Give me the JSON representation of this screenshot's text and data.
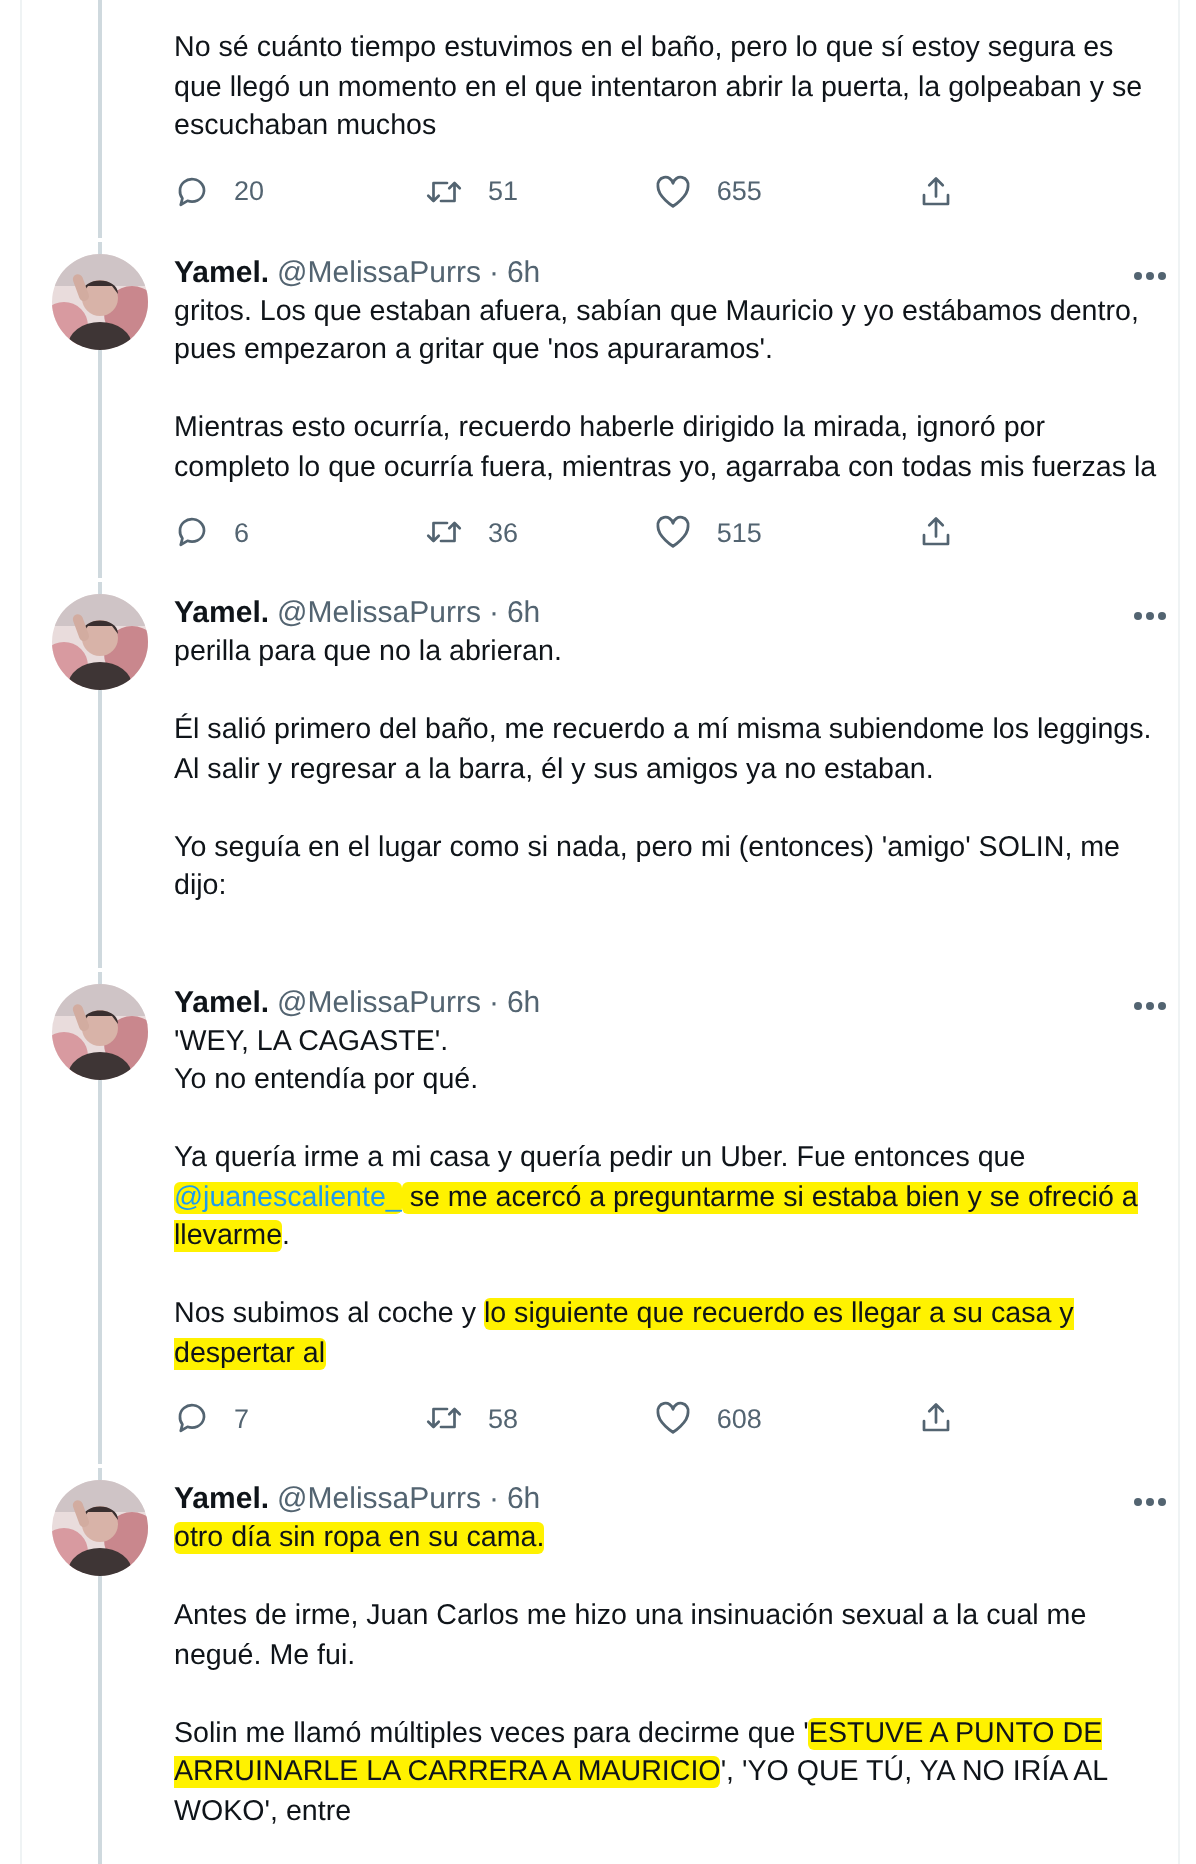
{
  "tweets": [
    {
      "paragraphs": [
        [
          {
            "kind": "text",
            "text": "No sé cuánto tiempo estuvimos en el baño, pero lo que sí estoy segura es que llegó un momento en el que intentaron abrir la puerta, la golpeaban y se escuchaban muchos",
            "highlight": false
          }
        ]
      ],
      "stats": {
        "replies": "20",
        "retweets": "51",
        "likes": "655"
      }
    },
    {
      "author": {
        "name": "Yamel.",
        "handle": "@MelissaPurrs",
        "dot": "·",
        "time": "6h"
      },
      "paragraphs": [
        [
          {
            "kind": "text",
            "text": "gritos. Los que estaban afuera, sabían que Mauricio y yo estábamos dentro, pues empezaron a gritar que 'nos apuraramos'.",
            "highlight": false
          }
        ],
        [
          {
            "kind": "text",
            "text": "Mientras esto ocurría, recuerdo haberle dirigido la mirada, ignoró por completo lo que ocurría fuera, mientras yo, agarraba con todas mis fuerzas la",
            "highlight": false
          }
        ]
      ],
      "stats": {
        "replies": "6",
        "retweets": "36",
        "likes": "515"
      }
    },
    {
      "author": {
        "name": "Yamel.",
        "handle": "@MelissaPurrs",
        "dot": "·",
        "time": "6h"
      },
      "paragraphs": [
        [
          {
            "kind": "text",
            "text": "perilla para que no la abrieran.",
            "highlight": false
          }
        ],
        [
          {
            "kind": "text",
            "text": "Él salió primero del baño, me recuerdo a mí misma subiendome los leggings.\nAl salir y regresar a la barra, él y sus amigos ya no estaban.",
            "highlight": false
          }
        ],
        [
          {
            "kind": "text",
            "text": "Yo seguía en el lugar como si nada, pero mi (entonces) 'amigo' SOLIN, me dijo:",
            "highlight": false
          }
        ]
      ]
    },
    {
      "author": {
        "name": "Yamel.",
        "handle": "@MelissaPurrs",
        "dot": "·",
        "time": "6h"
      },
      "paragraphs": [
        [
          {
            "kind": "text",
            "text": "'WEY, LA CAGASTE'.\nYo no entendía por qué.",
            "highlight": false
          }
        ],
        [
          {
            "kind": "text",
            "text": "Ya quería irme a mi casa y quería pedir un Uber. Fue entonces que ",
            "highlight": false
          },
          {
            "kind": "mention",
            "text": "@juanescaliente_",
            "highlight": true
          },
          {
            "kind": "text",
            "text": " se me acercó a preguntarme si estaba bien y se ofreció a llevarme",
            "highlight": true
          },
          {
            "kind": "text",
            "text": ".",
            "highlight": false
          }
        ],
        [
          {
            "kind": "text",
            "text": "Nos subimos al coche y ",
            "highlight": false
          },
          {
            "kind": "text",
            "text": "lo siguiente que recuerdo es llegar a su casa y despertar al",
            "highlight": true
          }
        ]
      ],
      "stats": {
        "replies": "7",
        "retweets": "58",
        "likes": "608"
      }
    },
    {
      "author": {
        "name": "Yamel.",
        "handle": "@MelissaPurrs",
        "dot": "·",
        "time": "6h"
      },
      "paragraphs": [
        [
          {
            "kind": "text",
            "text": "otro día sin ropa en su cama.",
            "highlight": true
          }
        ],
        [
          {
            "kind": "text",
            "text": "Antes de irme, Juan Carlos me hizo una insinuación sexual a la cual me negué. Me fui.",
            "highlight": false
          }
        ],
        [
          {
            "kind": "text",
            "text": "Solin me llamó múltiples veces para decirme que '",
            "highlight": false
          },
          {
            "kind": "text",
            "text": "ESTUVE A PUNTO DE ARRUINARLE LA CARRERA A MAURICIO",
            "highlight": true
          },
          {
            "kind": "text",
            "text": "', 'YO QUE TÚ, YA NO IRÍA AL WOKO', entre",
            "highlight": false
          }
        ]
      ]
    }
  ]
}
